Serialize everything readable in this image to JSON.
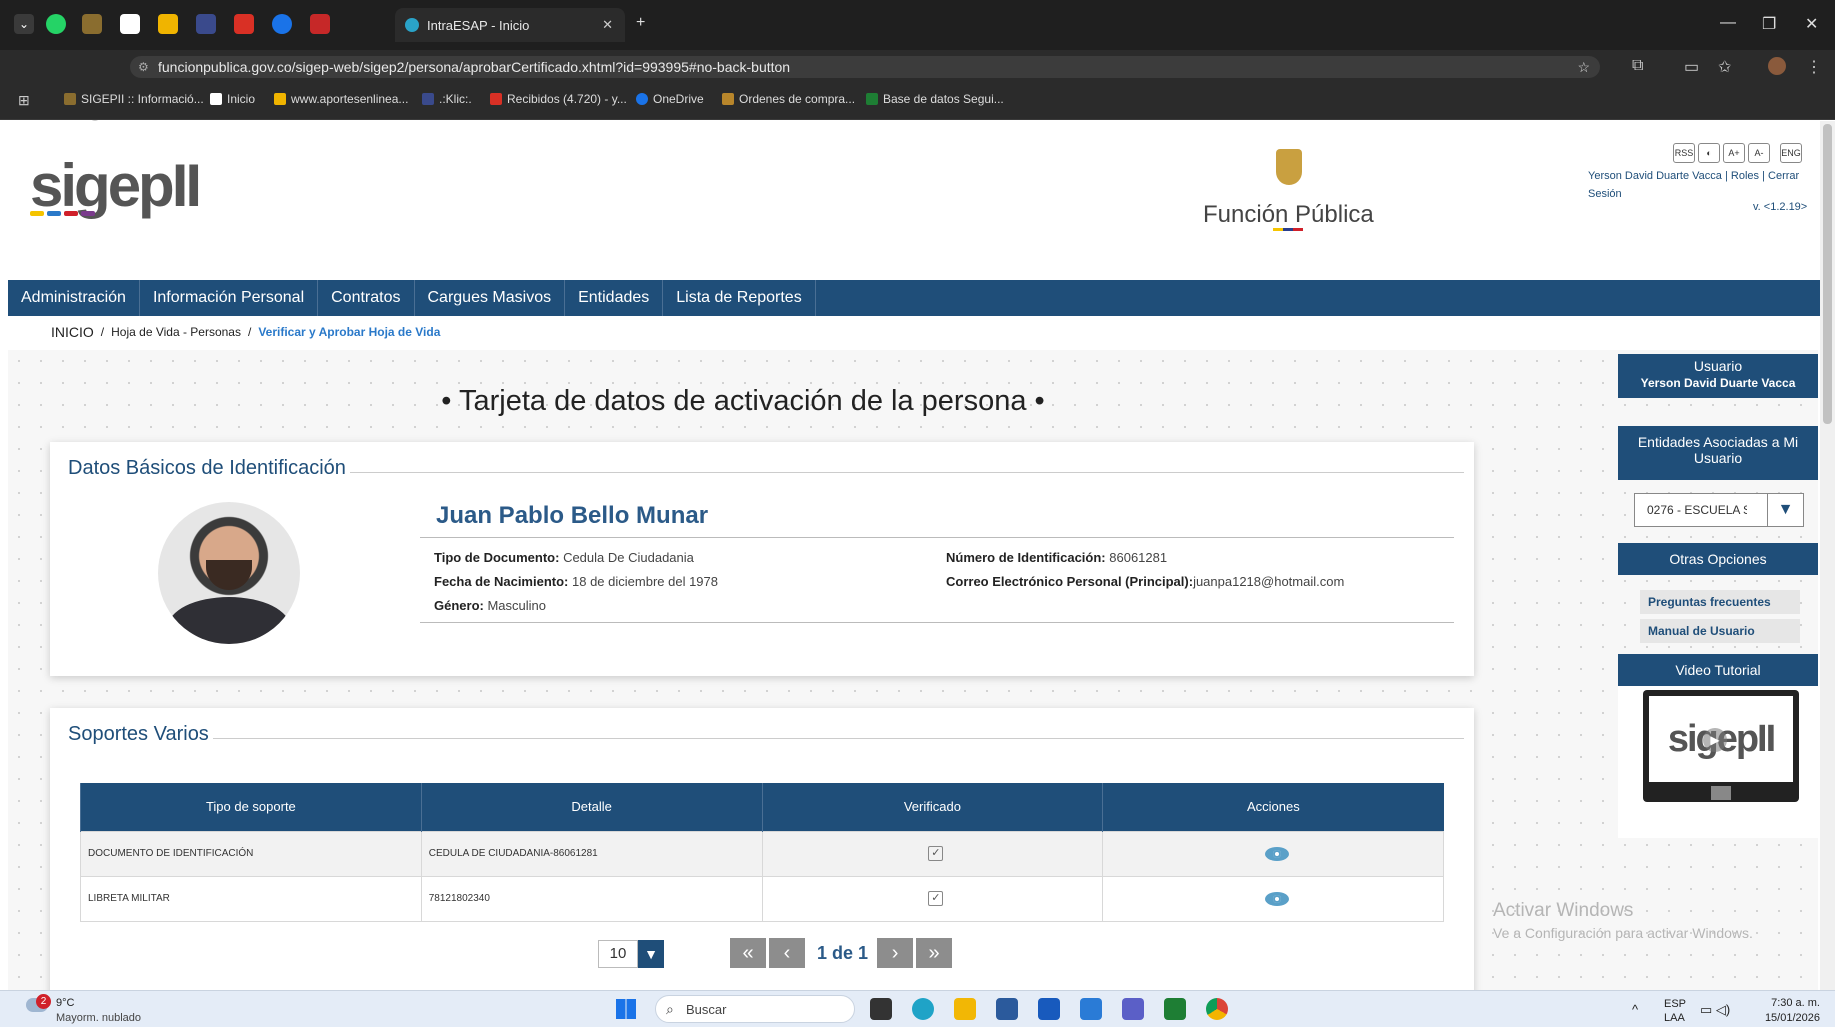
{
  "browser": {
    "active_tab_title": "IntraESAP - Inicio",
    "url": "funcionpublica.gov.co/sigep-web/sigep2/persona/aprobarCertificado.xhtml?id=993995#no-back-button",
    "bookmarks": [
      "SIGEPII :: Informació...",
      "Inicio",
      "www.aportesenlinea...",
      ".:Klic:.",
      "Recibidos (4.720) - y...",
      "OneDrive",
      "Ordenes de compra...",
      "Base de datos Segui..."
    ],
    "colors": {
      "accent": "#1f4e79",
      "link": "#2a79c9"
    }
  },
  "header": {
    "logo_text": "sigepII",
    "brand_text": "Función Pública",
    "access_buttons": [
      "RSS",
      "◐",
      "A+",
      "A-",
      "ENG"
    ],
    "user_name": "Yerson David Duarte Vacca",
    "roles_link": "Roles",
    "logout_link": "Cerrar Sesión",
    "version": "v. <1.2.19>"
  },
  "menu": [
    "Administración",
    "Información Personal",
    "Contratos",
    "Cargues Masivos",
    "Entidades",
    "Lista de Reportes"
  ],
  "breadcrumb": {
    "home": "INICIO",
    "sep": "/",
    "level1": "Hoja de Vida - Personas",
    "current": "Verificar y Aprobar Hoja de Vida"
  },
  "page_title": "• Tarjeta de datos de activación de la persona •",
  "basic": {
    "section_title": "Datos Básicos de Identificación",
    "name": "Juan Pablo Bello Munar",
    "doc_type_label": "Tipo de Documento:",
    "doc_type_value": "Cedula De Ciudadania",
    "birth_label": "Fecha de Nacimiento:",
    "birth_value": "18 de diciembre del 1978",
    "gender_label": "Género:",
    "gender_value": "Masculino",
    "id_label": "Número de Identificación:",
    "id_value": "86061281",
    "email_label": "Correo Electrónico Personal (Principal):",
    "email_value": "juanpa1218@hotmail.com"
  },
  "supports": {
    "section_title": "Soportes Varios",
    "columns": [
      "Tipo de soporte",
      "Detalle",
      "Verificado",
      "Acciones"
    ],
    "rows": [
      {
        "type": "DOCUMENTO DE IDENTIFICACIÓN",
        "detail": "CEDULA DE CIUDADANIA-86061281",
        "verified": true
      },
      {
        "type": "LIBRETA MILITAR",
        "detail": "78121802340",
        "verified": true
      }
    ],
    "page_size": "10",
    "page_info": "1 de 1"
  },
  "sidebar": {
    "user_heading": "Usuario",
    "user_name": "Yerson David Duarte Vacca",
    "entities_heading": "Entidades Asociadas a Mi Usuario",
    "entity_selected": "0276 - ESCUELA S",
    "other_heading": "Otras Opciones",
    "links": [
      "Preguntas frecuentes",
      "Manual de Usuario"
    ],
    "video_heading": "Video Tutorial",
    "video_logo": "sigepII"
  },
  "watermark": {
    "line1": "Activar Windows",
    "line2": "Ve a Configuración para activar Windows."
  },
  "taskbar": {
    "weather_temp": "9°C",
    "weather_desc": "Mayorm. nublado",
    "weather_badge": "2",
    "search_placeholder": "Buscar",
    "lang1": "ESP",
    "lang2": "LAA",
    "time": "7:30 a. m.",
    "date": "15/01/2026"
  }
}
